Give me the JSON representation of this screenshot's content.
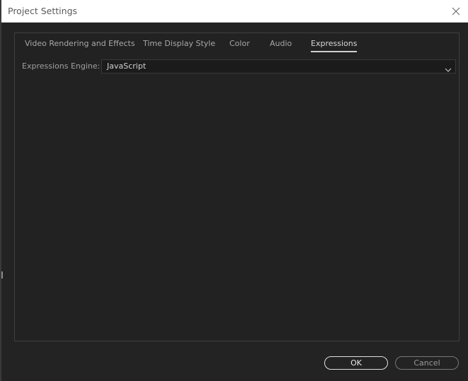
{
  "window": {
    "title": "Project Settings"
  },
  "tabs": [
    {
      "label": "Video Rendering and Effects",
      "active": false
    },
    {
      "label": "Time Display Style",
      "active": false
    },
    {
      "label": "Color",
      "active": false
    },
    {
      "label": "Audio",
      "active": false
    },
    {
      "label": "Expressions",
      "active": true
    }
  ],
  "expressions": {
    "engine_label": "Expressions Engine:",
    "engine_value": "JavaScript"
  },
  "buttons": {
    "ok": "OK",
    "cancel": "Cancel"
  },
  "icons": {
    "close": "close-icon",
    "dropdown": "chevron-down-icon"
  },
  "colors": {
    "background": "#232323",
    "titlebar": "#ffffff",
    "active_tab_underline": "#cfcfcf"
  }
}
